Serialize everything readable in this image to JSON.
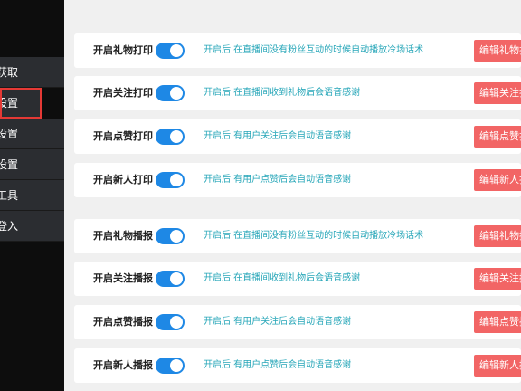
{
  "sidebar": {
    "items": [
      {
        "label": "获取",
        "active": false
      },
      {
        "label": "设置",
        "active": true
      },
      {
        "label": "设置",
        "active": false
      },
      {
        "label": "设置",
        "active": false
      },
      {
        "label": "工具",
        "active": false
      },
      {
        "label": "登入",
        "active": false
      }
    ]
  },
  "print_rows": [
    {
      "label": "开启礼物打印",
      "enabled": true,
      "description": "开启后 在直播间没有粉丝互动的时候自动播放冷场话术",
      "button": "编辑礼物打印"
    },
    {
      "label": "开启关注打印",
      "enabled": true,
      "description": "开启后 在直播间收到礼物后会语音感谢",
      "button": "编辑关注打印"
    },
    {
      "label": "开启点赞打印",
      "enabled": true,
      "description": "开启后 有用户关注后会自动语音感谢",
      "button": "编辑点赞打印"
    },
    {
      "label": "开启新人打印",
      "enabled": true,
      "description": "开启后 有用户点赞后会自动语音感谢",
      "button": "编辑新人打印"
    }
  ],
  "broadcast_rows": [
    {
      "label": "开启礼物播报",
      "enabled": true,
      "description": "开启后 在直播间没有粉丝互动的时候自动播放冷场话术",
      "button": "编辑礼物播报"
    },
    {
      "label": "开启关注播报",
      "enabled": true,
      "description": "开启后 在直播间收到礼物后会语音感谢",
      "button": "编辑关注播报"
    },
    {
      "label": "开启点赞播报",
      "enabled": true,
      "description": "开启后 有用户关注后会自动语音感谢",
      "button": "编辑点赞播报"
    },
    {
      "label": "开启新人播报",
      "enabled": true,
      "description": "开启后 有用户点赞后会自动语音感谢",
      "button": "编辑新人播报"
    }
  ],
  "colors": {
    "toggle_on": "#1e88e5",
    "description_text": "#26a6b8",
    "edit_button": "#f26565",
    "sidebar_bg": "#0d0d0d",
    "active_outline": "#e53935"
  }
}
